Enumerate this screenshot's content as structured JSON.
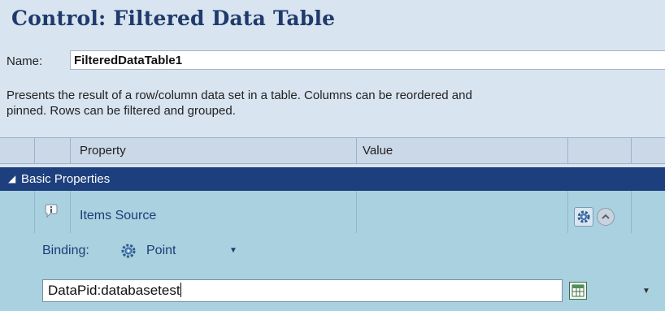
{
  "header": {
    "title": "Control: Filtered Data Table"
  },
  "name": {
    "label": "Name:",
    "value": "FilteredDataTable1"
  },
  "description": {
    "line1": "Presents the result of a row/column data set in a table. Columns can be reordered and",
    "line2": "pinned. Rows can be filtered and grouped."
  },
  "grid": {
    "columns": [
      {
        "label": "Property"
      },
      {
        "label": "Value"
      }
    ]
  },
  "group": {
    "arrow": "◢",
    "label": "Basic Properties"
  },
  "item": {
    "label": "Items Source",
    "info_icon": "info-icon",
    "gear_icon": "gear-icon",
    "collapse_icon": "chevron-up-icon"
  },
  "binding": {
    "label": "Binding:",
    "value": "Point",
    "caret": "▼"
  },
  "expression": {
    "value": "DataPid:databasetest",
    "caret": "▼"
  },
  "colors": {
    "title": "#1f3a6b",
    "group_bg": "#1d3f7d",
    "selected_bg": "#a9d1df",
    "header_bg": "#cad8e8"
  }
}
